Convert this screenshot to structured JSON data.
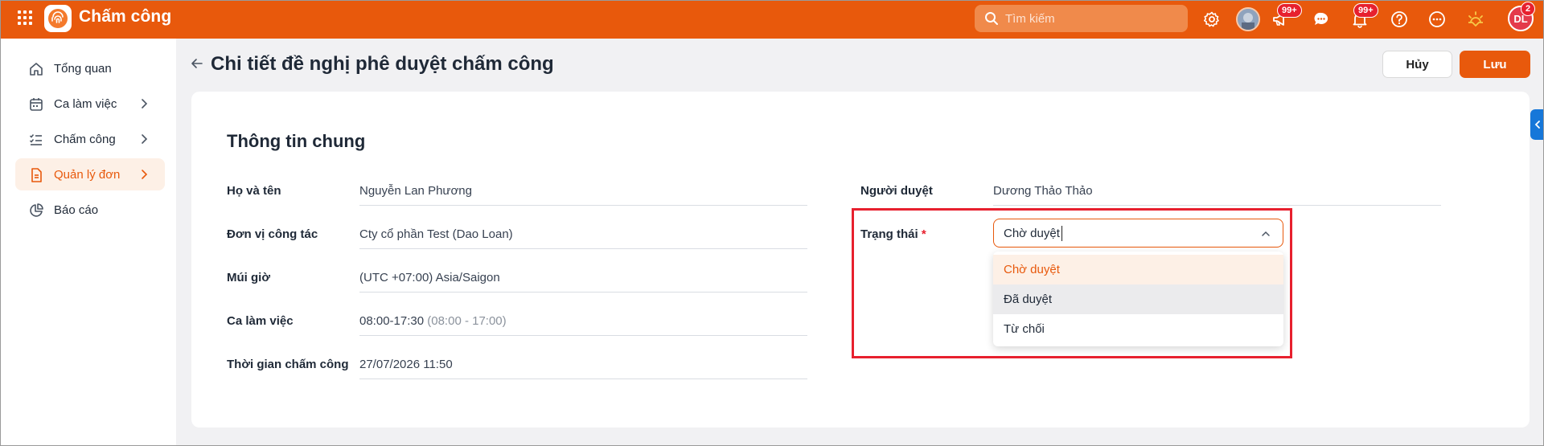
{
  "app": {
    "title": "Chấm công"
  },
  "search": {
    "placeholder": "Tìm kiếm"
  },
  "topbar": {
    "badge_announcements": "99+",
    "badge_notifications": "99+",
    "user_initials": "DL",
    "user_badge": "2",
    "accent_color": "#e8590c"
  },
  "sidebar": {
    "items": [
      {
        "label": "Tổng quan",
        "icon": "home-icon"
      },
      {
        "label": "Ca làm việc",
        "icon": "calendar-icon"
      },
      {
        "label": "Chấm công",
        "icon": "checklist-icon"
      },
      {
        "label": "Quản lý đơn",
        "icon": "document-icon",
        "active": true
      },
      {
        "label": "Báo cáo",
        "icon": "pie-chart-icon"
      }
    ]
  },
  "header": {
    "title": "Chi tiết đề nghị phê duyệt chấm công",
    "cancel_label": "Hủy",
    "save_label": "Lưu"
  },
  "form": {
    "section_title": "Thông tin chung",
    "fields": [
      {
        "label": "Họ và tên",
        "value": "Nguyễn Lan Phương"
      },
      {
        "label": "Đơn vị công tác",
        "value": "Cty cổ phần Test (Dao Loan)"
      },
      {
        "label": "Múi giờ",
        "value": "(UTC +07:00) Asia/Saigon"
      },
      {
        "label": "Ca làm việc",
        "value": "08:00-17:30",
        "value_note": "(08:00 - 17:00)"
      },
      {
        "label": "Thời gian chấm công",
        "value": "27/07/2026 11:50"
      }
    ],
    "approver": {
      "label": "Người duyệt",
      "value": "Dương Thảo Thảo"
    },
    "status": {
      "label": "Trạng thái",
      "required_mark": "*",
      "value": "Chờ duyệt",
      "options": [
        "Chờ duyệt",
        "Đã duyệt",
        "Từ chối"
      ]
    }
  }
}
